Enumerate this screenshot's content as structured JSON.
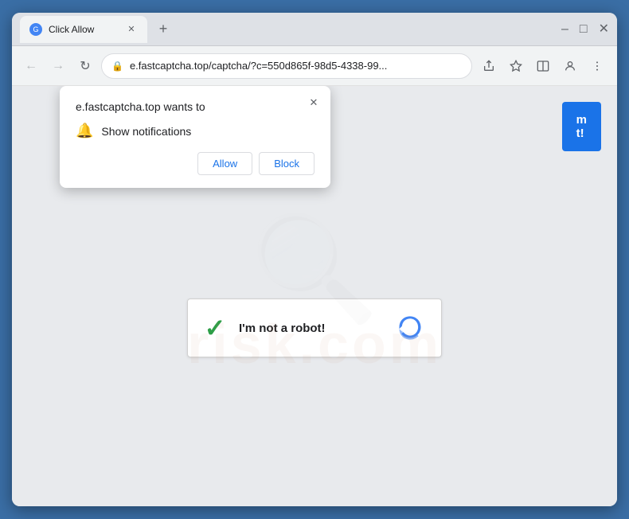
{
  "browser": {
    "tab": {
      "title": "Click Allow",
      "favicon_label": "G"
    },
    "controls": {
      "minimize": "–",
      "maximize": "□",
      "close": "✕"
    },
    "address": {
      "url": "e.fastcaptcha.top/captcha/?c=550d865f-98d5-4338-99...",
      "lock_icon": "🔒"
    },
    "new_tab_icon": "+",
    "back_icon": "←",
    "forward_icon": "→",
    "reload_icon": "↻",
    "share_icon": "⬆",
    "bookmark_icon": "☆",
    "split_icon": "▣",
    "profile_icon": "👤",
    "menu_icon": "⋮"
  },
  "popup": {
    "title": "e.fastcaptcha.top wants to",
    "notification_label": "Show notifications",
    "close_icon": "✕",
    "bell_icon": "🔔",
    "allow_label": "Allow",
    "block_label": "Block"
  },
  "page": {
    "blue_button_line1": "m",
    "blue_button_line2": "t!",
    "captcha_label": "I'm not a robot!",
    "watermark_text": "risk.com"
  }
}
